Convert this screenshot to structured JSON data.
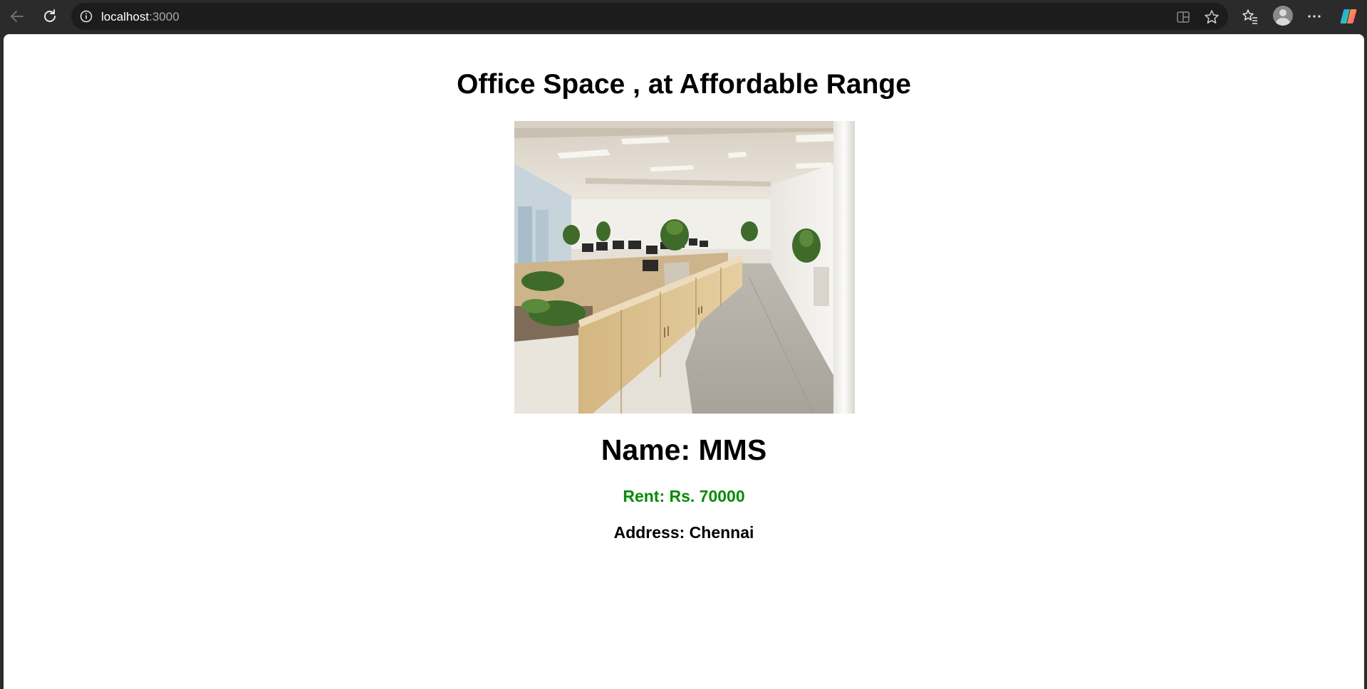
{
  "browser": {
    "url_host": "localhost",
    "url_port": ":3000",
    "icons": [
      "back-icon",
      "refresh-icon",
      "site-info-icon",
      "split-screen-icon",
      "favorite-star-icon",
      "favorites-icon",
      "profile-avatar-icon",
      "more-options-icon",
      "copilot-icon"
    ]
  },
  "page": {
    "title": "Office Space , at Affordable Range",
    "name_line": "Name: MMS",
    "rent_line": "Rent: Rs. 70000",
    "address_line": "Address: Chennai",
    "rent_color": "#0a8a0a"
  }
}
